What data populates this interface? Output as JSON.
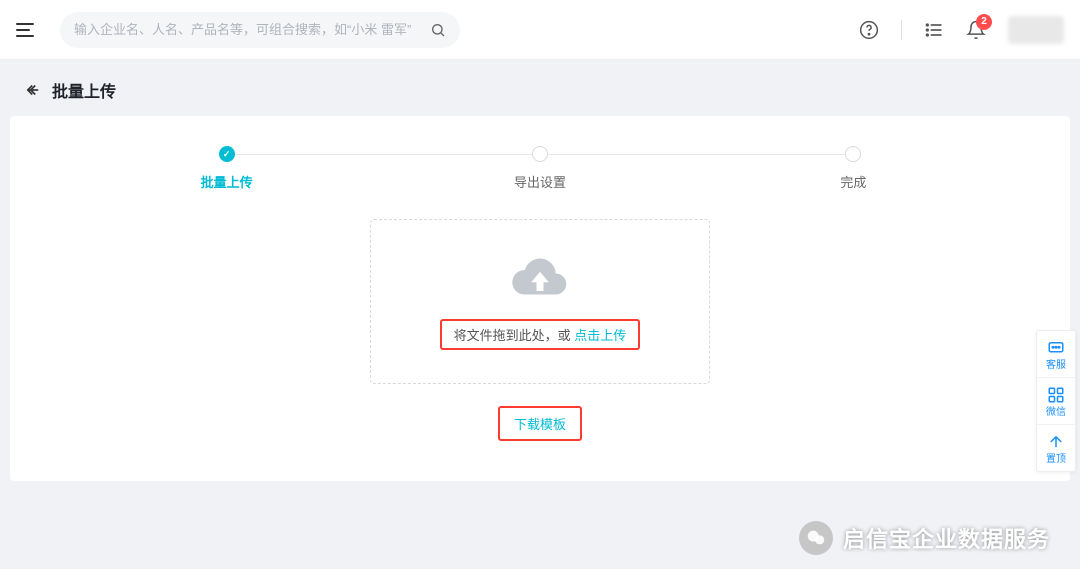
{
  "header": {
    "search_placeholder": "输入企业名、人名、产品名等，可组合搜索，如“小米 雷军”",
    "notification_count": "2"
  },
  "page": {
    "title": "批量上传"
  },
  "stepper": {
    "steps": [
      {
        "label": "批量上传"
      },
      {
        "label": "导出设置"
      },
      {
        "label": "完成"
      }
    ]
  },
  "upload": {
    "prefix_text": "将文件拖到此处，或 ",
    "link_text": "点击上传",
    "download_template_label": "下载模板"
  },
  "float_sidebar": {
    "items": [
      {
        "label": "客服"
      },
      {
        "label": "微信"
      },
      {
        "label": "置顶"
      }
    ]
  },
  "watermark": {
    "text": "启信宝企业数据服务"
  }
}
